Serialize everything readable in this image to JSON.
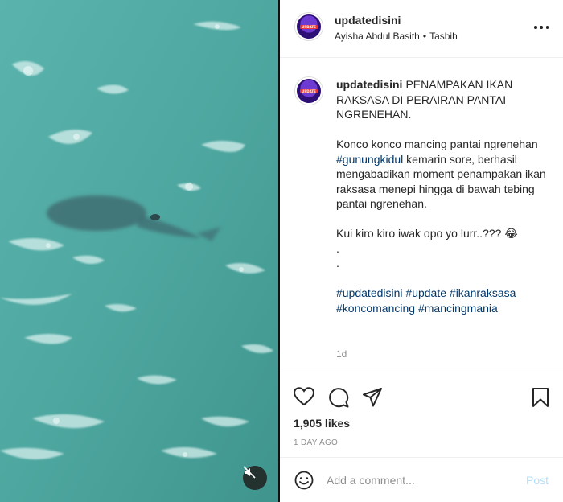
{
  "header": {
    "username": "updatedisini",
    "subtitle_name": "Ayisha Abdul Basith",
    "subtitle_separator": "•",
    "subtitle_audio": "Tasbih"
  },
  "avatar_badge": "UPDATE",
  "caption": {
    "username": "updatedisini",
    "title": "PENAMPAKAN IKAN RAKSASA DI PERAIRAN PANTAI NGRENEHAN.",
    "p1_before": "Konco konco mancing pantai ngrenehan ",
    "p1_hashtag": "#gunungkidul",
    "p1_after": " kemarin sore, berhasil mengabadikan moment penampakan ikan raksasa menepi hingga di bawah tebing pantai ngrenehan.",
    "p2": "Kui kiro kiro iwak opo yo lurr..??? 😂",
    "dot1": ".",
    "dot2": ".",
    "hashtags": [
      "#updatedisini",
      "#update",
      "#ikanraksasa",
      "#koncomancing",
      "#mancingmania"
    ]
  },
  "caption_age": "1d",
  "likes": "1,905 likes",
  "posted": "1 DAY AGO",
  "comment": {
    "placeholder": "Add a comment...",
    "post_label": "Post"
  },
  "icons": {
    "like": "heart-icon",
    "comment": "comment-icon",
    "share": "paper-plane-icon",
    "save": "bookmark-icon",
    "emoji": "smiley-icon",
    "mute": "speaker-muted-icon",
    "more": "more-options-icon"
  },
  "colors": {
    "sea": "#4fa9a2",
    "hashtag": "#00376b",
    "post_disabled": "#b2dffc",
    "muted_text": "#8e8e8e"
  }
}
